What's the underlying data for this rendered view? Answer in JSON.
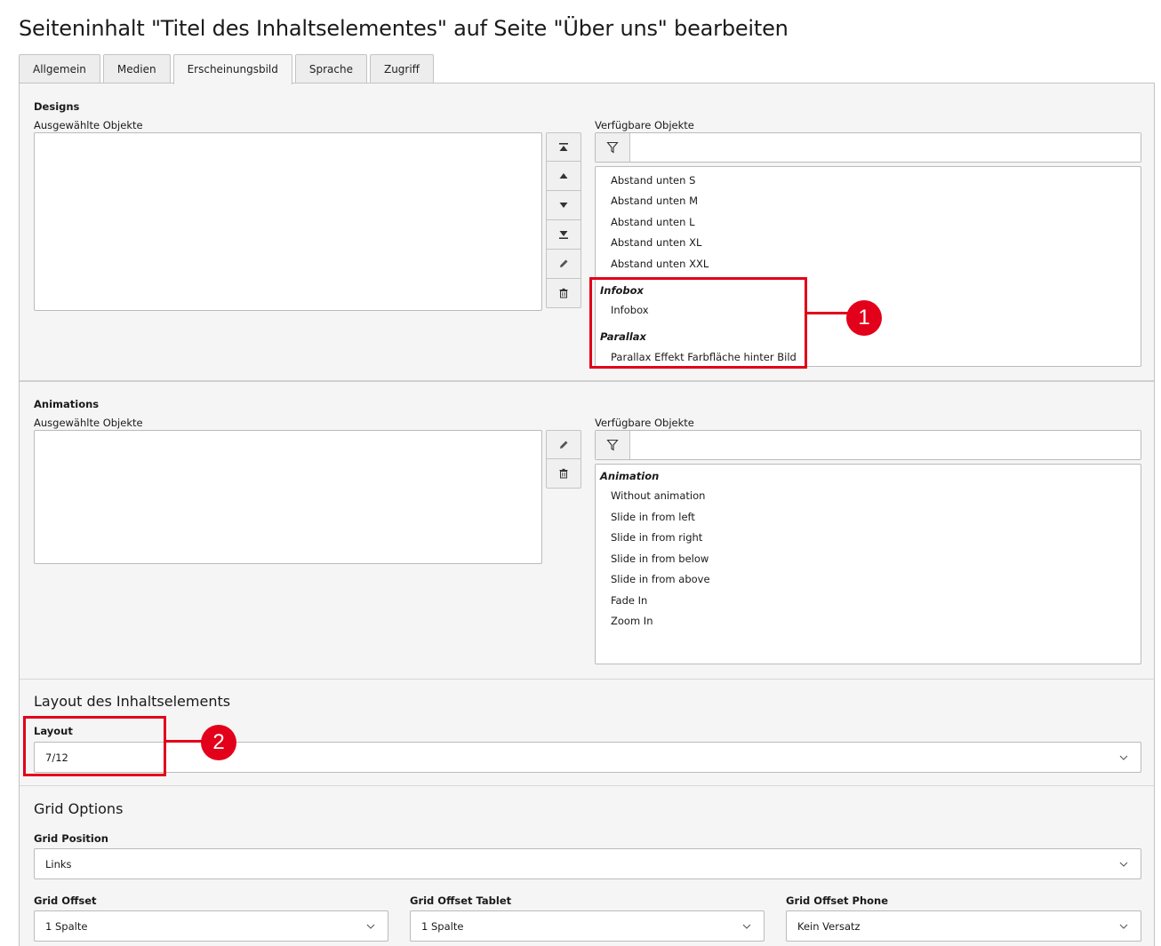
{
  "page": {
    "title": "Seiteninhalt \"Titel des Inhaltselementes\" auf Seite \"Über uns\" bearbeiten"
  },
  "tabs": [
    {
      "label": "Allgemein",
      "active": false
    },
    {
      "label": "Medien",
      "active": false
    },
    {
      "label": "Erscheinungsbild",
      "active": true
    },
    {
      "label": "Sprache",
      "active": false
    },
    {
      "label": "Zugriff",
      "active": false
    }
  ],
  "designs": {
    "heading": "Designs",
    "selected_label": "Ausgewählte Objekte",
    "available_label": "Verfügbare Objekte",
    "filter_placeholder": "",
    "buttons": [
      "move-to-top-icon",
      "move-up-icon",
      "move-down-icon",
      "move-to-bottom-icon",
      "pencil-icon",
      "trash-icon"
    ],
    "options": [
      "Abstand unten S",
      "Abstand unten M",
      "Abstand unten L",
      "Abstand unten XL",
      "Abstand unten XXL"
    ],
    "group_infobox": "Infobox",
    "infobox_options": [
      "Infobox"
    ],
    "group_parallax": "Parallax",
    "parallax_options": [
      "Parallax Effekt Farbfläche hinter Bild"
    ]
  },
  "animations": {
    "heading": "Animations",
    "selected_label": "Ausgewählte Objekte",
    "available_label": "Verfügbare Objekte",
    "filter_placeholder": "",
    "group_label": "Animation",
    "options": [
      "Without animation",
      "Slide in from left",
      "Slide in from right",
      "Slide in from below",
      "Slide in from above",
      "Fade In",
      "Zoom In"
    ]
  },
  "layout": {
    "heading": "Layout des Inhaltselements",
    "field_label": "Layout",
    "value": "7/12"
  },
  "grid": {
    "heading": "Grid Options",
    "position_label": "Grid Position",
    "position_value": "Links",
    "offset_label": "Grid Offset",
    "offset_value": "1 Spalte",
    "offset_tablet_label": "Grid Offset Tablet",
    "offset_tablet_value": "1 Spalte",
    "offset_phone_label": "Grid Offset Phone",
    "offset_phone_value": "Kein Versatz"
  },
  "annotations": {
    "badge_1": "1",
    "badge_2": "2",
    "color": "#e2001a"
  }
}
